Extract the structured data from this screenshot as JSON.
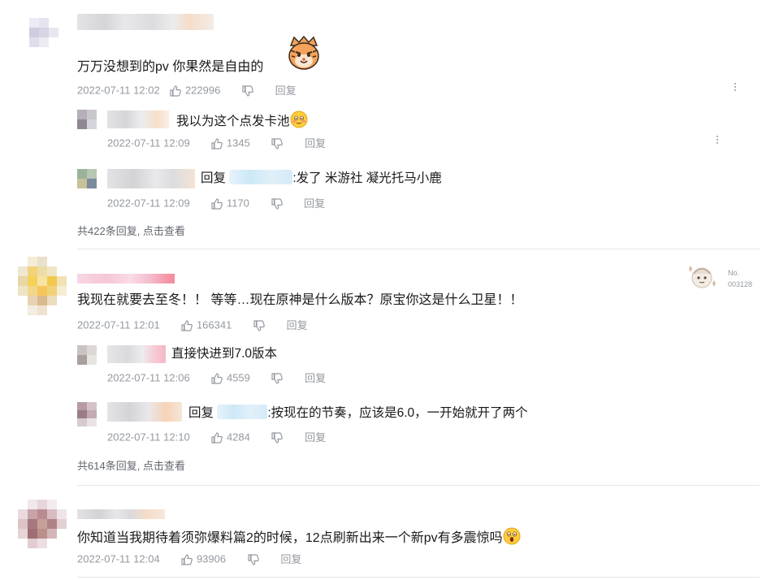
{
  "comments": [
    {
      "text": "万万没想到的pv 你果然是自由的",
      "time": "2022-07-11 12:02",
      "likes": "222996",
      "reply_label": "回复",
      "replies": [
        {
          "text": "我以为这个点发卡池",
          "time": "2022-07-11 12:09",
          "likes": "1345",
          "reply_label": "回复"
        },
        {
          "prefix": "回复",
          "text": ":发了 米游社 凝光托马小鹿",
          "time": "2022-07-11 12:09",
          "likes": "1170",
          "reply_label": "回复"
        }
      ],
      "view_more": "共422条回复, 点击查看"
    },
    {
      "text": "我现在就要去至冬！！ 等等…现在原神是什么版本？原宝你这是什么卫星！！",
      "time": "2022-07-11 12:01",
      "likes": "166341",
      "reply_label": "回复",
      "badge_label": "No.",
      "badge_number": "003128",
      "replies": [
        {
          "text": "直接快进到7.0版本",
          "time": "2022-07-11 12:06",
          "likes": "4559",
          "reply_label": "回复"
        },
        {
          "prefix": "回复",
          "text": ":按现在的节奏，应该是6.0，一开始就开了两个",
          "time": "2022-07-11 12:10",
          "likes": "4284",
          "reply_label": "回复"
        }
      ],
      "view_more": "共614条回复, 点击查看"
    },
    {
      "text": "你知道当我期待着须弥爆料篇2的时候，12点刷新出来一个新pv有多震惊吗",
      "time": "2022-07-11 12:04",
      "likes": "93906",
      "reply_label": "回复"
    }
  ],
  "icons": {
    "like": "thumb-up-icon",
    "dislike": "thumb-down-icon",
    "more": "more-vertical-icon"
  },
  "colors": {
    "text": "#18191c",
    "meta": "#9499a0",
    "pink_name": "#fb7299"
  }
}
